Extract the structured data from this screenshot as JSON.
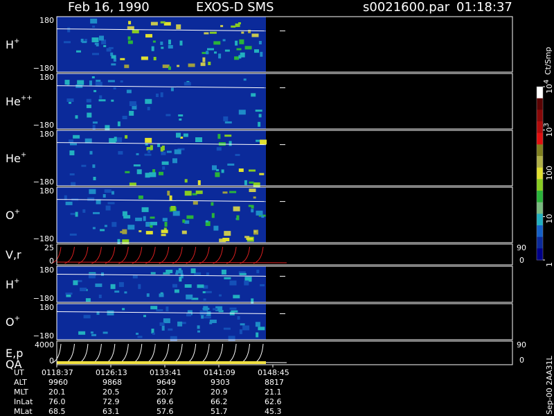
{
  "header": {
    "date": "Feb 16, 1990",
    "instrument": "EXOS-D SMS",
    "file": "s0021600.par",
    "time": "01:18:37"
  },
  "colorbar": {
    "unit": "Ct/Smp",
    "labels": [
      {
        "base": "10",
        "exp": "4",
        "value": 10000
      },
      {
        "base": "10",
        "exp": "3",
        "value": 1000
      },
      {
        "base": "100",
        "exp": "",
        "value": 100
      },
      {
        "base": "10",
        "exp": "",
        "value": 10
      },
      {
        "base": "1",
        "exp": "",
        "value": 1
      }
    ],
    "colors": [
      "#000088",
      "#0b2a9a",
      "#1560c8",
      "#22b0c0",
      "#7aba80",
      "#2ab43a",
      "#88cc22",
      "#e0e030",
      "#b0b048",
      "#808020",
      "#e01010",
      "#b00c0c",
      "#880808",
      "#5a0404",
      "#ffffff"
    ]
  },
  "footer_code": "Sep-00  2AA31L",
  "chart_data": {
    "type": "heatmap",
    "title": "Feb 16, 1990   EXOS-D SMS",
    "panels": [
      {
        "id": "Hp",
        "base": "H",
        "sup": "+",
        "y_top": "180",
        "y_bottom": "−180",
        "ylim": [
          -180,
          180
        ],
        "kind": "spectrogram"
      },
      {
        "id": "Hepp",
        "base": "He",
        "sup": "++",
        "y_top": "180",
        "y_bottom": "−180",
        "ylim": [
          -180,
          180
        ],
        "kind": "spectrogram"
      },
      {
        "id": "Hep",
        "base": "He",
        "sup": "+",
        "y_top": "180",
        "y_bottom": "−180",
        "ylim": [
          -180,
          180
        ],
        "kind": "spectrogram"
      },
      {
        "id": "Op",
        "base": "O",
        "sup": "+",
        "y_top": "180",
        "y_bottom": "−180",
        "ylim": [
          -180,
          180
        ],
        "kind": "spectrogram"
      },
      {
        "id": "Vr",
        "base": "V,r",
        "sup": "",
        "y_top": "25",
        "y_bottom": "0",
        "right_top": "90",
        "right_bottom": "0",
        "ylim": [
          0,
          25
        ],
        "kind": "lines"
      },
      {
        "id": "Hp2",
        "base": "H",
        "sup": "+",
        "y_top": "180",
        "y_bottom": "−180",
        "ylim": [
          -180,
          180
        ],
        "kind": "spectrogram"
      },
      {
        "id": "Op2",
        "base": "O",
        "sup": "+",
        "y_top": "180",
        "y_bottom": "−180",
        "ylim": [
          -180,
          180
        ],
        "kind": "spectrogram"
      },
      {
        "id": "Ep",
        "base": "E,p",
        "sup": "",
        "base2": "QA",
        "y_top": "4000",
        "y_bottom": "0",
        "right_top": "90",
        "right_bottom": "0",
        "ylim": [
          0,
          4000
        ],
        "kind": "lines"
      }
    ],
    "x_ticks": [
      "0118:37",
      "0126:13",
      "0133:41",
      "0141:09",
      "0148:45"
    ],
    "ephemeris": [
      {
        "label": "UT",
        "values": [
          "0118:37",
          "0126:13",
          "0133:41",
          "0141:09",
          "0148:45"
        ]
      },
      {
        "label": "ALT",
        "values": [
          "9960",
          "9868",
          "9649",
          "9303",
          "8817"
        ]
      },
      {
        "label": "MLT",
        "values": [
          "20.1",
          "20.5",
          "20.7",
          "20.9",
          "21.1"
        ]
      },
      {
        "label": "InLat",
        "values": [
          "76.0",
          "72.9",
          "69.6",
          "66.2",
          "62.6"
        ]
      },
      {
        "label": "MLat",
        "values": [
          "68.5",
          "63.1",
          "57.6",
          "51.7",
          "45.3"
        ]
      }
    ]
  }
}
